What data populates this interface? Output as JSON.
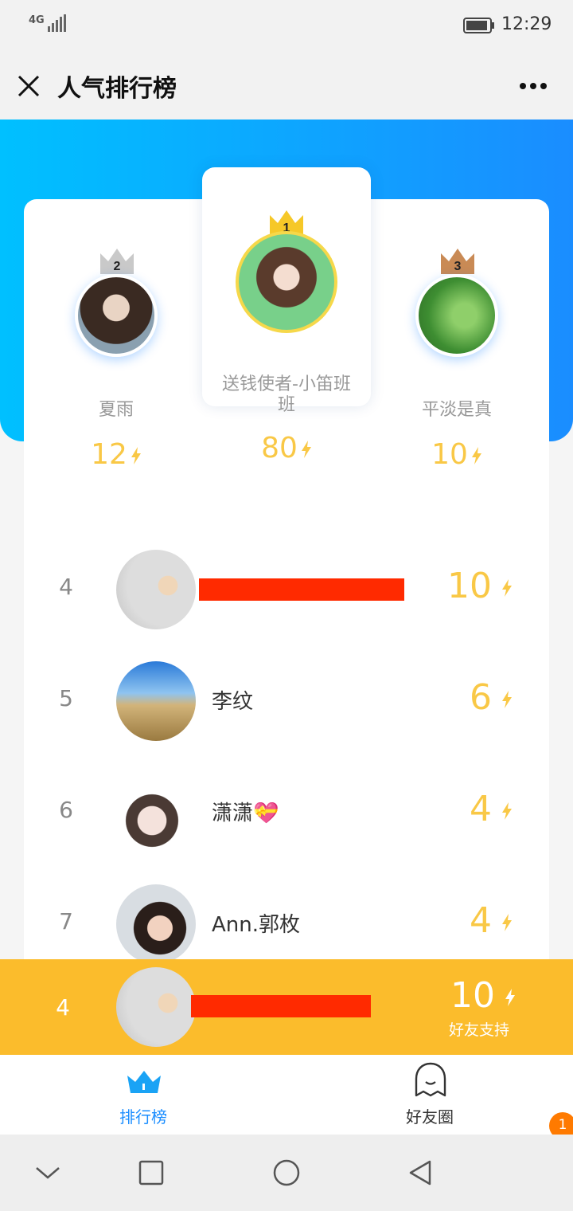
{
  "status": {
    "network": "4G",
    "time": "12:29"
  },
  "header": {
    "title": "人气排行榜"
  },
  "podium": [
    {
      "rank": "2",
      "name": "夏雨",
      "score": "12"
    },
    {
      "rank": "1",
      "name": "送钱使者-小笛班班",
      "score": "80"
    },
    {
      "rank": "3",
      "name": "平淡是真",
      "score": "10"
    }
  ],
  "rankings": [
    {
      "rank": "4",
      "name": "",
      "score": "10"
    },
    {
      "rank": "5",
      "name": "李纹",
      "score": "6"
    },
    {
      "rank": "6",
      "name": "潇潇💝",
      "score": "4"
    },
    {
      "rank": "7",
      "name": "Ann.郭枚",
      "score": "4"
    }
  ],
  "me": {
    "rank": "4",
    "score": "10",
    "caption": "好友支持"
  },
  "tabs": [
    {
      "label": "排行榜",
      "active": true,
      "icon": "crown-icon"
    },
    {
      "label": "好友圈",
      "active": false,
      "icon": "ghost-icon"
    }
  ],
  "badge": {
    "count": "1"
  },
  "colors": {
    "accent": "#1a8dff",
    "gold": "#f9c846",
    "highlight": "#fbbc2c",
    "redaction": "#ff2a00"
  }
}
